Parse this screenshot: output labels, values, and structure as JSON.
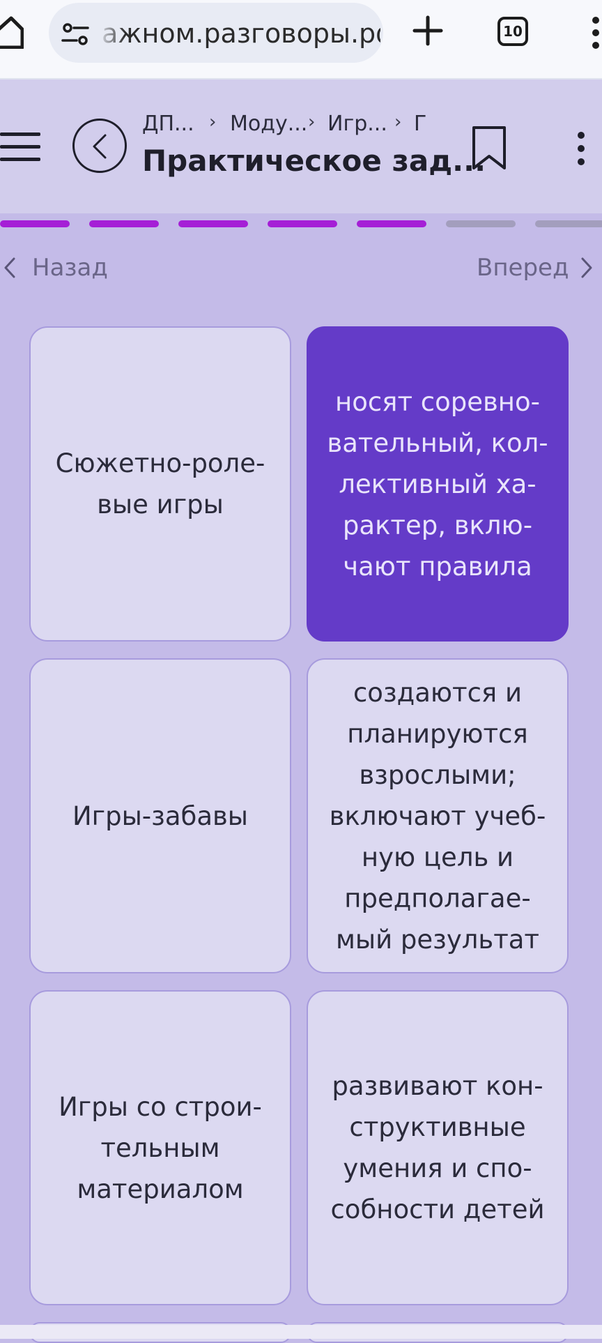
{
  "browser": {
    "url": "ажном.разговоры.рф",
    "tab_count": "10"
  },
  "header": {
    "breadcrumb": [
      "ДП...",
      "Моду...",
      "Игр...",
      "Г"
    ],
    "title": "Практическое зад..."
  },
  "progress": {
    "total_segments": 7,
    "completed_segments": 5,
    "active_color": "#a51fd6",
    "inactive_color": "#a39ebd"
  },
  "nav": {
    "prev_label": "Назад",
    "next_label": "Вперед"
  },
  "cards": [
    {
      "text": "Сюжетно-роле-\nвые игры",
      "selected": false
    },
    {
      "text": "носят соревно-\nвательный, кол-\nлективный ха-\nрактер, вклю-\nчают правила",
      "selected": true
    },
    {
      "text": "Игры-забавы",
      "selected": false
    },
    {
      "text": "создаются и\nпланируются\nвзрослыми;\nвключают учеб-\nную цель и\nпредполагае-\nмый результат",
      "selected": false
    },
    {
      "text": "Игры со строи-\nтельным\nматериалом",
      "selected": false
    },
    {
      "text": "развивают кон-\nструктивные\nумения и спо-\nсобности детей",
      "selected": false
    }
  ],
  "colors": {
    "page_bg": "#c4bbe8",
    "header_bg": "#d2cdec",
    "card_bg": "#dcd9f1",
    "card_selected_bg": "#643bc8"
  }
}
